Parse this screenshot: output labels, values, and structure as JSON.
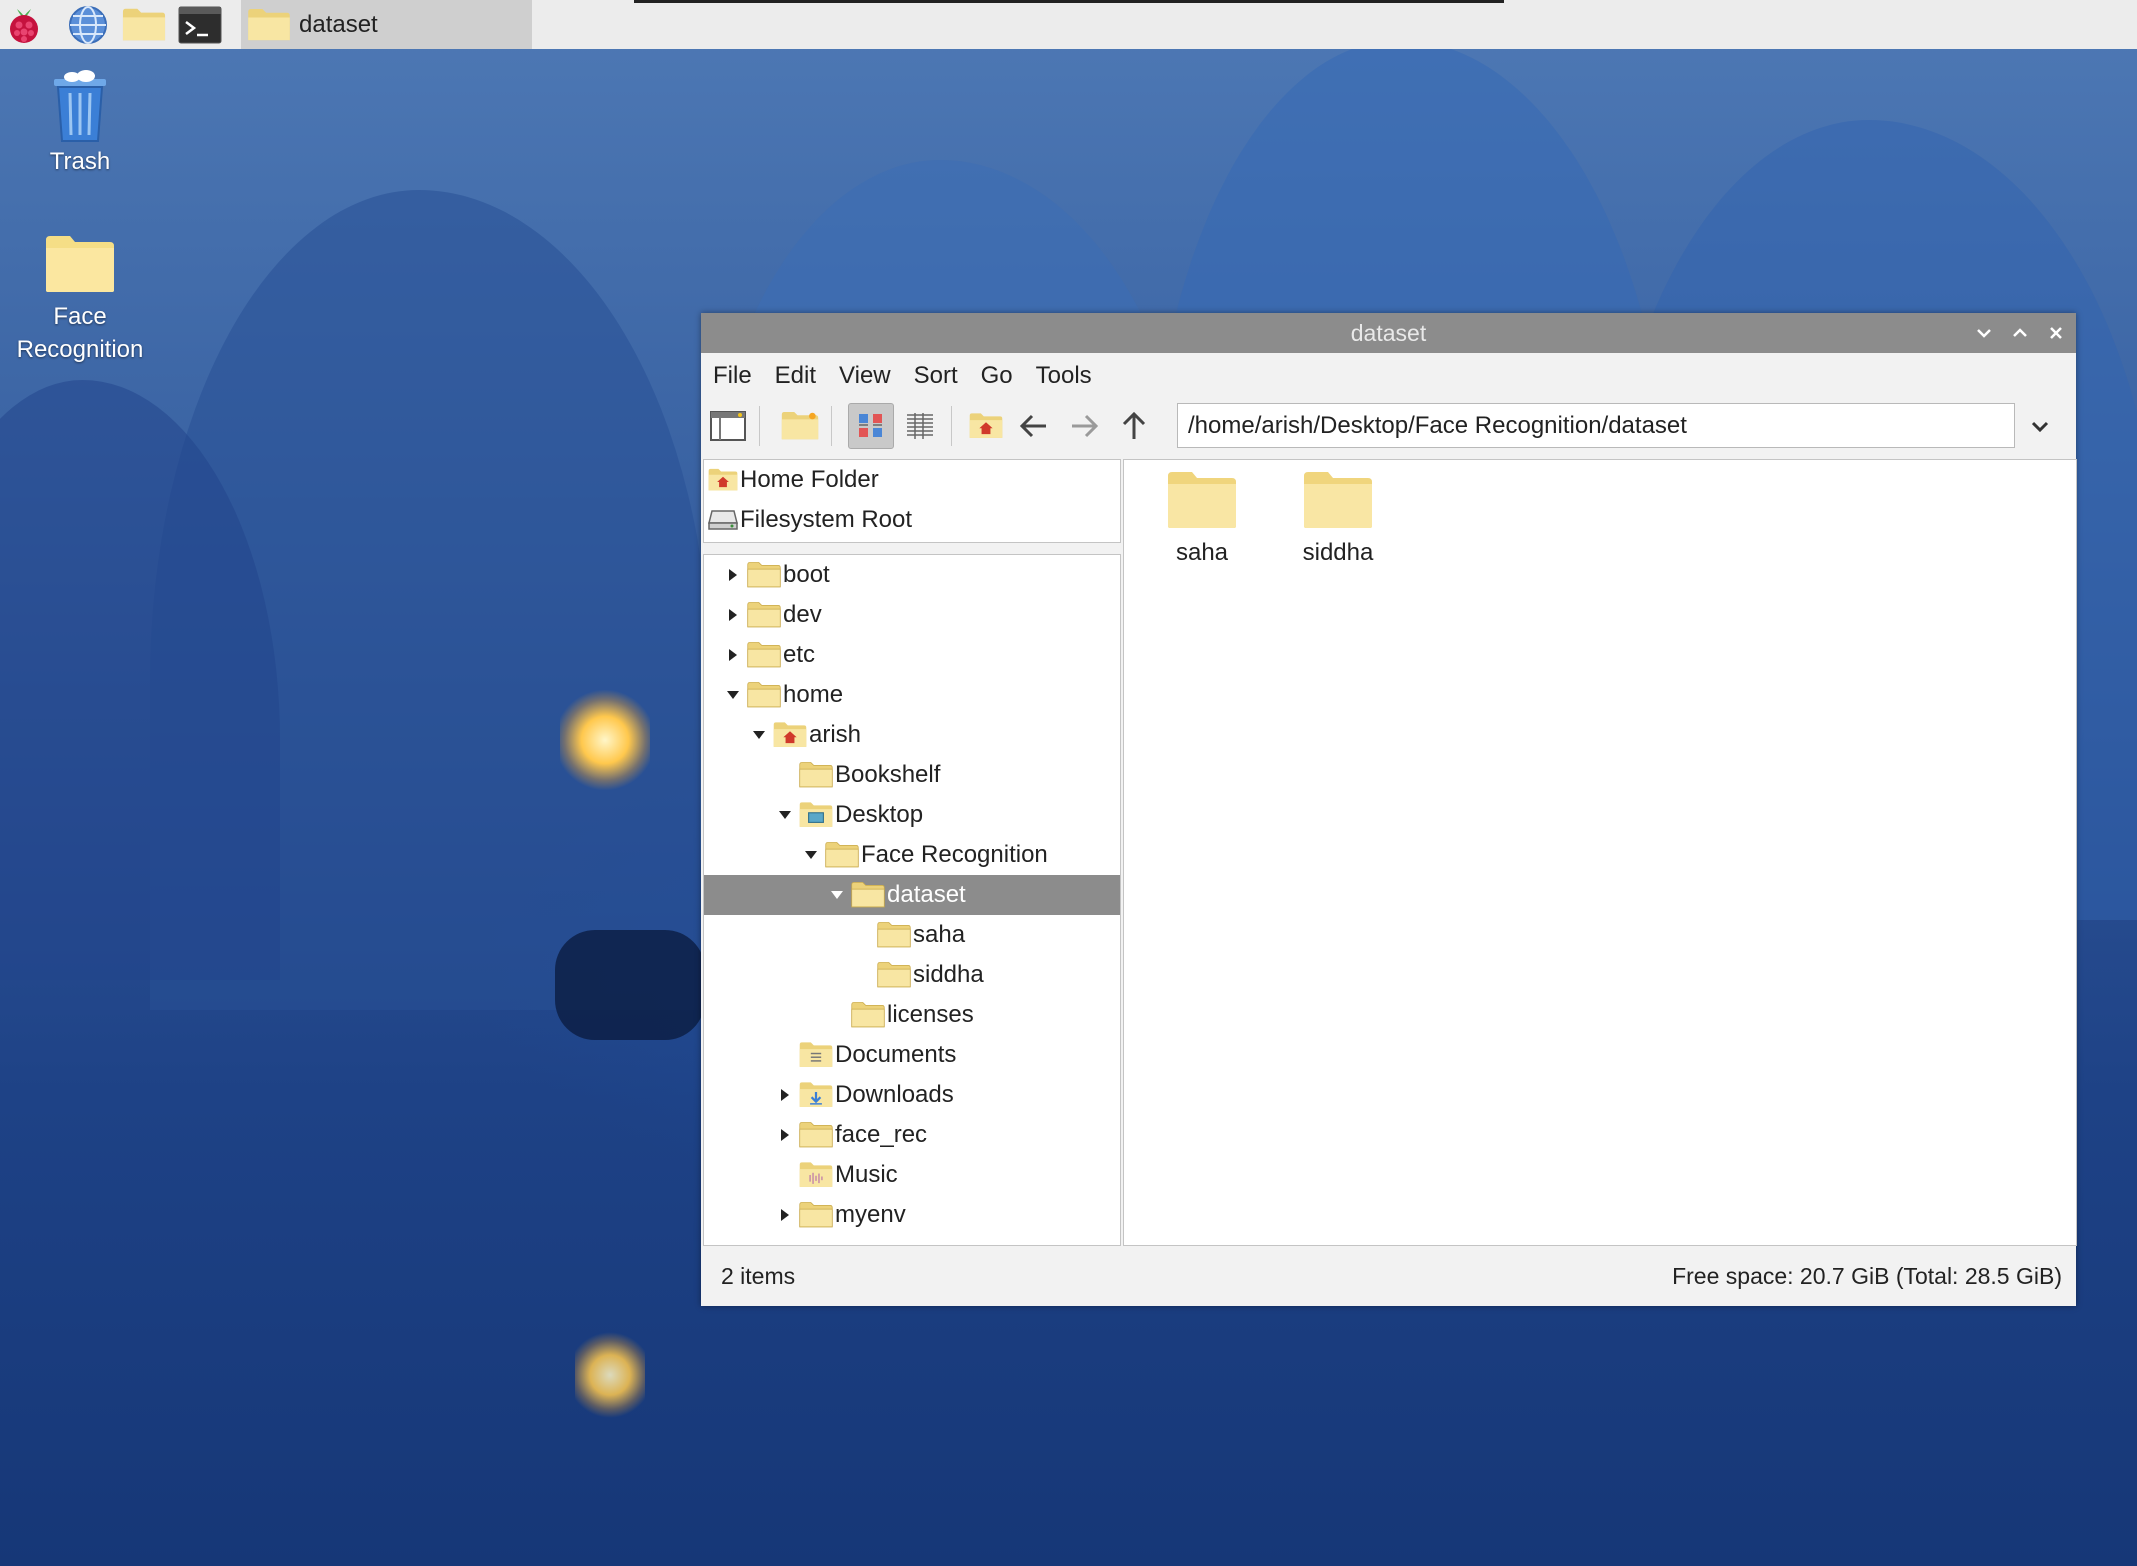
{
  "taskbar": {
    "task_label": "dataset"
  },
  "desktop": {
    "icons": [
      {
        "label": "Trash",
        "icon": "trash-icon"
      },
      {
        "label": "Face\nRecognition",
        "icon": "folder-icon"
      }
    ]
  },
  "window": {
    "title": "dataset",
    "menu": [
      "File",
      "Edit",
      "View",
      "Sort",
      "Go",
      "Tools"
    ],
    "path": "/home/arish/Desktop/Face Recognition/dataset",
    "places": [
      {
        "label": "Home Folder",
        "icon": "home-icon"
      },
      {
        "label": "Filesystem Root",
        "icon": "drive-icon"
      }
    ],
    "tree": [
      {
        "label": "boot",
        "expander": "collapsed",
        "icon": "folder-icon"
      },
      {
        "label": "dev",
        "expander": "collapsed",
        "icon": "folder-icon"
      },
      {
        "label": "etc",
        "expander": "collapsed",
        "icon": "folder-icon"
      },
      {
        "label": "home",
        "expander": "expanded",
        "icon": "folder-icon"
      },
      {
        "label": "arish",
        "expander": "expanded",
        "icon": "home-icon"
      },
      {
        "label": "Bookshelf",
        "expander": "none",
        "icon": "folder-icon"
      },
      {
        "label": "Desktop",
        "expander": "expanded",
        "icon": "desktop-folder-icon"
      },
      {
        "label": "Face Recognition",
        "expander": "expanded",
        "icon": "folder-icon"
      },
      {
        "label": "dataset",
        "expander": "expanded",
        "icon": "folder-icon",
        "selected": true
      },
      {
        "label": "saha",
        "expander": "none",
        "icon": "folder-icon"
      },
      {
        "label": "siddha",
        "expander": "none",
        "icon": "folder-icon"
      },
      {
        "label": "licenses",
        "expander": "none",
        "icon": "folder-icon"
      },
      {
        "label": "Documents",
        "expander": "none",
        "icon": "documents-folder-icon"
      },
      {
        "label": "Downloads",
        "expander": "collapsed",
        "icon": "downloads-folder-icon"
      },
      {
        "label": "face_rec",
        "expander": "collapsed",
        "icon": "folder-icon"
      },
      {
        "label": "Music",
        "expander": "none",
        "icon": "music-folder-icon"
      },
      {
        "label": "myenv",
        "expander": "collapsed",
        "icon": "folder-icon"
      }
    ],
    "items": [
      {
        "label": "saha",
        "icon": "folder-icon"
      },
      {
        "label": "siddha",
        "icon": "folder-icon"
      }
    ],
    "status": {
      "count": "2 items",
      "free_space": "Free space: 20.7 GiB (Total: 28.5 GiB)"
    }
  },
  "colors": {
    "selection": "#8c8c8c",
    "folder": "#f7e08e",
    "titlebar": "#8c8c8c"
  }
}
